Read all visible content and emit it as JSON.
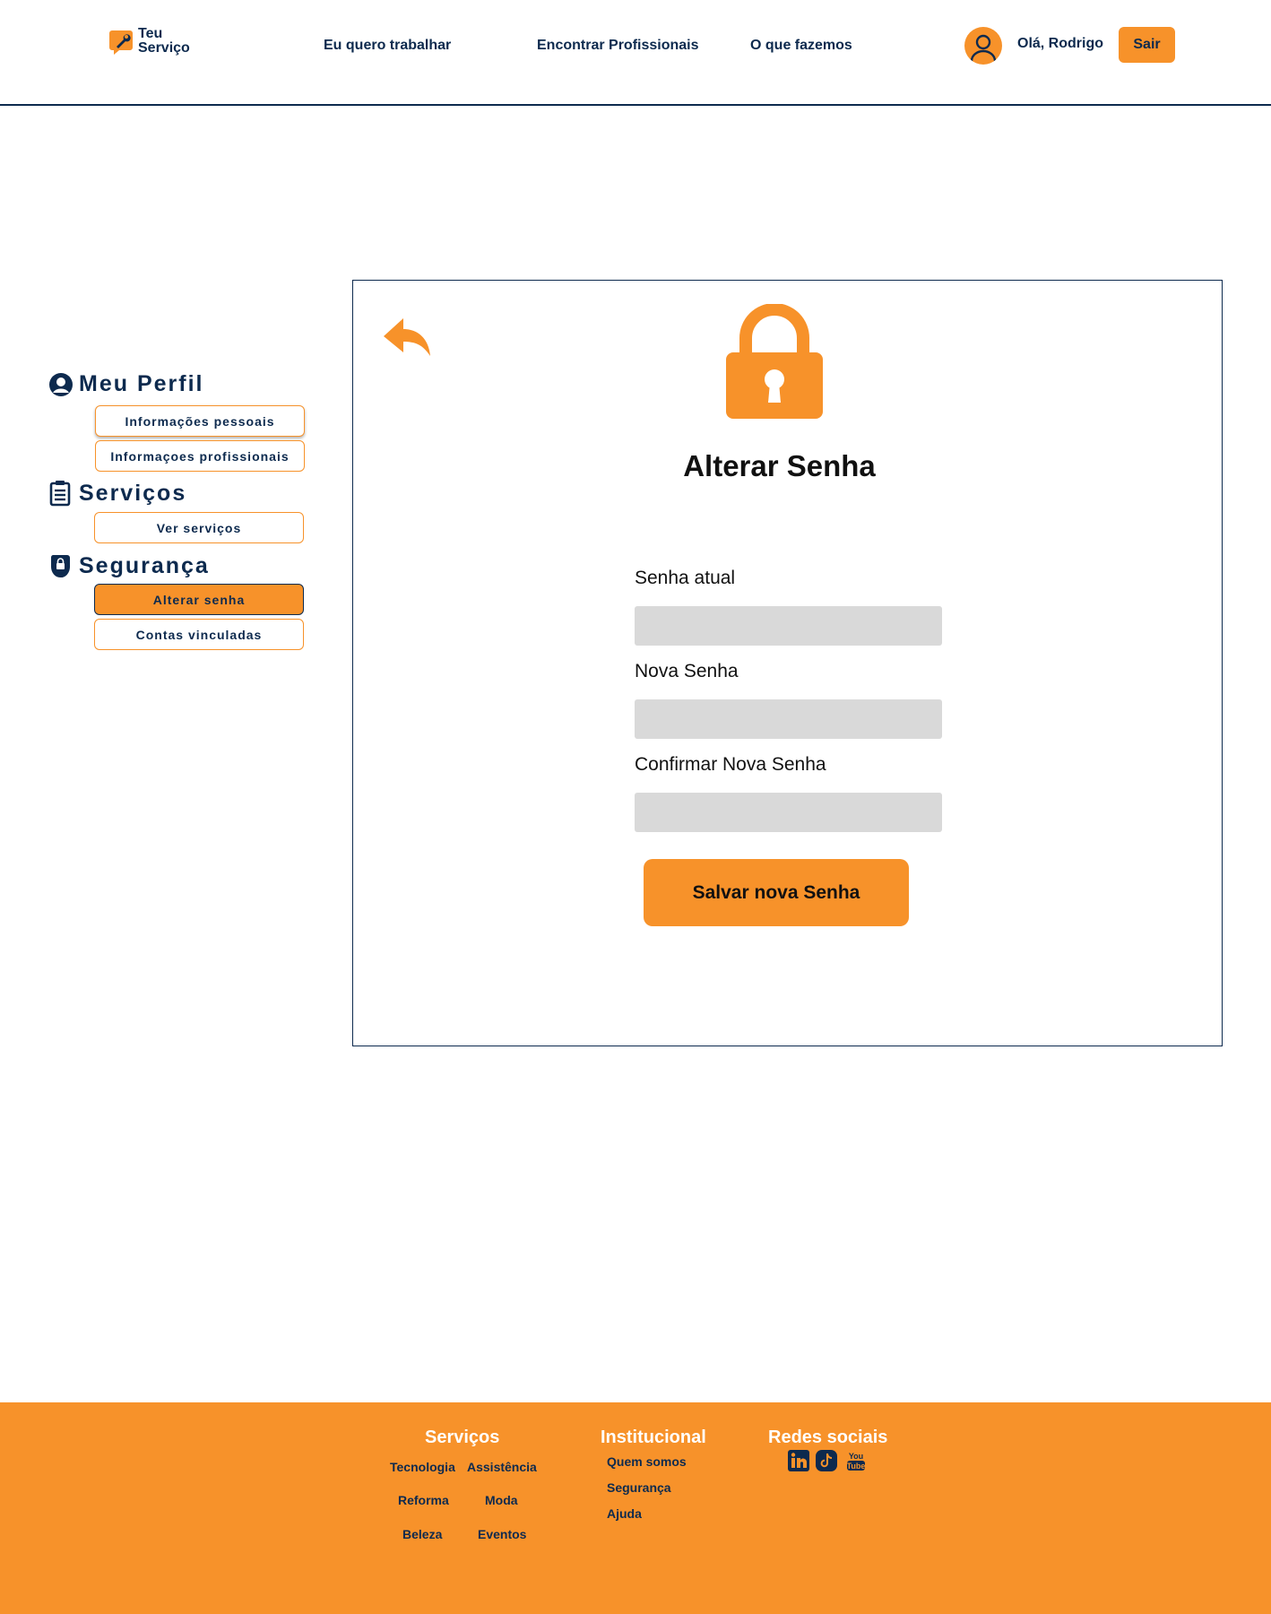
{
  "header": {
    "logo_text": "Teu\nServiço",
    "nav": [
      {
        "label": "Eu quero trabalhar"
      },
      {
        "label": "Encontrar Profissionais"
      },
      {
        "label": "O que fazemos"
      }
    ],
    "greeting": "Olá, Rodrigo",
    "logout_label": "Sair"
  },
  "sidebar": {
    "sections": [
      {
        "title": "Meu Perfil",
        "icon": "user-circle-icon",
        "items": [
          {
            "label": "Informações pessoais"
          },
          {
            "label": "Informaçoes profissionais"
          }
        ]
      },
      {
        "title": "Serviços",
        "icon": "clipboard-icon",
        "items": [
          {
            "label": "Ver serviços"
          }
        ]
      },
      {
        "title": "Segurança",
        "icon": "shield-lock-icon",
        "items": [
          {
            "label": "Alterar senha",
            "active": true
          },
          {
            "label": "Contas vinculadas"
          }
        ]
      }
    ]
  },
  "main": {
    "title": "Alterar Senha",
    "fields": [
      {
        "label": "Senha atual",
        "value": ""
      },
      {
        "label": "Nova Senha",
        "value": ""
      },
      {
        "label": "Confirmar Nova Senha",
        "value": ""
      }
    ],
    "save_label": "Salvar nova Senha"
  },
  "footer": {
    "services": {
      "heading": "Serviços",
      "links": [
        "Tecnologia",
        "Assistência",
        "Reforma",
        "Moda",
        "Beleza",
        "Eventos"
      ]
    },
    "institutional": {
      "heading": "Institucional",
      "links": [
        "Quem somos",
        "Segurança",
        "Ajuda"
      ]
    },
    "social": {
      "heading": "Redes sociais",
      "icons": [
        "linkedin-icon",
        "tiktok-icon",
        "youtube-icon"
      ],
      "youtube_text": "You\nTube"
    }
  },
  "colors": {
    "accent": "#f7922a",
    "navy": "#0d2a4e",
    "input_bg": "#d9d9d9"
  }
}
